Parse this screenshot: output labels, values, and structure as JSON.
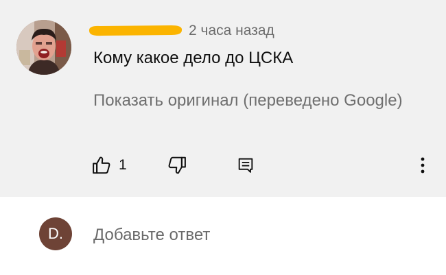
{
  "comment": {
    "timestamp": "2 часа назад",
    "text": "Кому какое дело до ЦСКА",
    "translate_link": "Показать оригинал (переведено Google)",
    "likes": "1"
  },
  "icons": {
    "like": "thumbs-up-icon",
    "dislike": "thumbs-down-icon",
    "reply": "comment-icon",
    "more": "more-vert-icon"
  },
  "reply_box": {
    "user_initial": "D.",
    "placeholder": "Добавьте ответ"
  },
  "colors": {
    "card_background": "#f1f1f1",
    "redaction_highlight": "#fbb400",
    "user_avatar": "#6e4336"
  }
}
